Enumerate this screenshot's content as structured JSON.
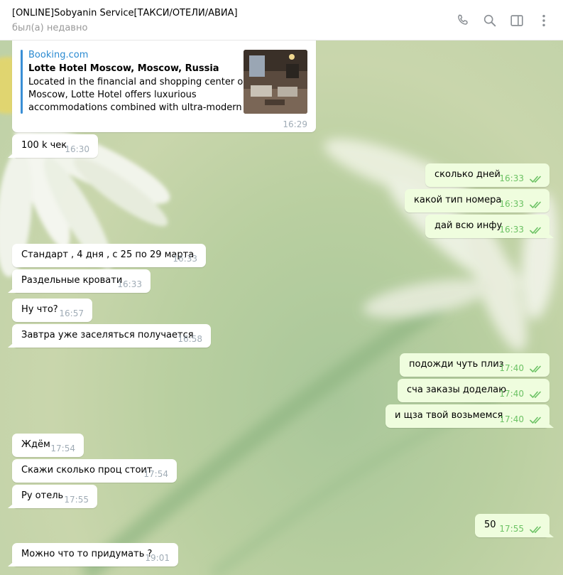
{
  "header": {
    "title": "[ONLINE]Sobyanin Service[ТАКСИ/ОТЕЛИ/АВИА]",
    "status": "был(а) недавно",
    "icons": [
      "phone-icon",
      "search-icon",
      "sidebar-toggle-icon",
      "more-vert-icon"
    ]
  },
  "preview": {
    "site": "Booking.com",
    "title": "Lotte Hotel Moscow, Moscow, Russia",
    "desc_lines": [
      "Located in the financial and shopping center of",
      "Moscow, Lotte Hotel offers luxurious",
      "accommodations combined with ultra-modern f..."
    ],
    "time": "16:29"
  },
  "messages": [
    {
      "dir": "in",
      "text": "100 k чек",
      "time": "16:30"
    },
    {
      "dir": "out",
      "text": "сколько дней",
      "time": "16:33"
    },
    {
      "dir": "out",
      "text": "какой тип номера",
      "time": "16:33"
    },
    {
      "dir": "out",
      "text": "дай всю инфу",
      "time": "16:33"
    },
    {
      "dir": "in",
      "text": "Стандарт , 4 дня , с 25 по 29 марта",
      "time": "16:33"
    },
    {
      "dir": "in",
      "text": "Раздельные кровати",
      "time": "16:33"
    },
    {
      "dir": "in",
      "text": "Ну что?",
      "time": "16:57"
    },
    {
      "dir": "in",
      "text": "Завтра уже заселяться получается",
      "time": "16:58"
    },
    {
      "dir": "out",
      "text": "подожди чуть плиз",
      "time": "17:40"
    },
    {
      "dir": "out",
      "text": "сча заказы доделаю",
      "time": "17:40"
    },
    {
      "dir": "out",
      "text": "и щза твой возьмемся",
      "time": "17:40"
    },
    {
      "dir": "in",
      "text": "Ждём",
      "time": "17:54"
    },
    {
      "dir": "in",
      "text": "Скажи сколько проц стоит",
      "time": "17:54"
    },
    {
      "dir": "in",
      "text": "Ру отель",
      "time": "17:55"
    },
    {
      "dir": "out",
      "text": "50",
      "time": "17:55"
    },
    {
      "dir": "in",
      "text": "Можно что то придумать ?",
      "time": "19:01"
    }
  ],
  "colors": {
    "incoming_bubble": "#ffffff",
    "outgoing_bubble": "#effdde",
    "read_check": "#6cc264",
    "link": "#2a8ad1"
  }
}
